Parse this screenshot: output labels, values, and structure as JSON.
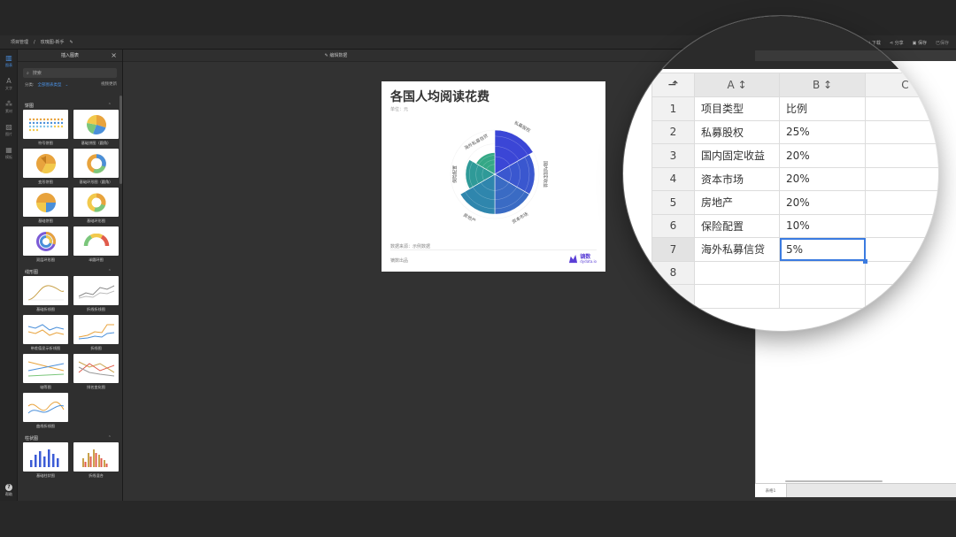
{
  "toolbar": {
    "breadcrumb_project": "项目管理",
    "breadcrumb_sep": "/",
    "breadcrumb_name": "玫瑰图-新手",
    "edit_icon": "edit-icon",
    "download": "下载",
    "share": "分享",
    "save": "保存",
    "saved_status": "已保存"
  },
  "rail": {
    "items": [
      {
        "label": "图表",
        "icon": "chart-icon"
      },
      {
        "label": "文字",
        "icon": "text-icon"
      },
      {
        "label": "素材",
        "icon": "material-icon"
      },
      {
        "label": "图片",
        "icon": "image-icon"
      },
      {
        "label": "模板",
        "icon": "template-icon"
      }
    ],
    "help": "帮助"
  },
  "panel": {
    "title": "插入图表",
    "search_placeholder": "搜索",
    "filter_label": "分类:",
    "filter_value": "全部图表类型",
    "filter_more": "视频更新",
    "sections": [
      {
        "title": "饼图",
        "items": [
          "符号饼图",
          "基础饼图（圆角）",
          "变形饼图",
          "基础环形图（圆角）",
          "基础饼图",
          "基础环形图",
          "双层环形图",
          "半圆环图"
        ]
      },
      {
        "title": "线形图",
        "items": [
          "基础折线图",
          "折线折线图",
          "带差值显示折线图",
          "折线图",
          "轴等图",
          "排名变化图",
          "曲线折线图"
        ]
      },
      {
        "title": "柱状图",
        "items": [
          "基础柱状图",
          "折线混合"
        ]
      }
    ]
  },
  "subbar": {
    "label": "编辑数据"
  },
  "chart": {
    "title": "各国人均阅读花费",
    "unit": "单位：元",
    "source": "数据来源：示例数据",
    "footer": "镝数出品",
    "logo_name": "镝数",
    "logo_url": "dydata.io"
  },
  "chart_data": {
    "type": "pie",
    "subtype": "nightingale-rose",
    "title": "各国人均阅读花费",
    "categories": [
      "私募股权",
      "国内固定收益",
      "资本市场",
      "房地产",
      "保险配置",
      "海外私募信贷"
    ],
    "values": [
      25,
      20,
      20,
      20,
      10,
      5
    ],
    "colors": [
      "#3b46d6",
      "#3a57cf",
      "#3a6bc4",
      "#2f86ad",
      "#2f9a98",
      "#35a886"
    ]
  },
  "right_panel": {
    "tab_active": "编辑数据",
    "tab_other": "图表样式",
    "sheet_tab": "表格1"
  },
  "spreadsheet": {
    "col_headers": [
      "A",
      "B",
      "C"
    ],
    "rows": [
      {
        "n": "1",
        "a": "项目类型",
        "b": "比例"
      },
      {
        "n": "2",
        "a": "私募股权",
        "b": "25%"
      },
      {
        "n": "3",
        "a": "国内固定收益",
        "b": "20%"
      },
      {
        "n": "4",
        "a": "资本市场",
        "b": "20%"
      },
      {
        "n": "5",
        "a": "房地产",
        "b": "20%"
      },
      {
        "n": "6",
        "a": "保险配置",
        "b": "10%"
      },
      {
        "n": "7",
        "a": "海外私募信贷",
        "b": "5%"
      },
      {
        "n": "8",
        "a": "",
        "b": ""
      }
    ],
    "selected_cell": "B7"
  }
}
